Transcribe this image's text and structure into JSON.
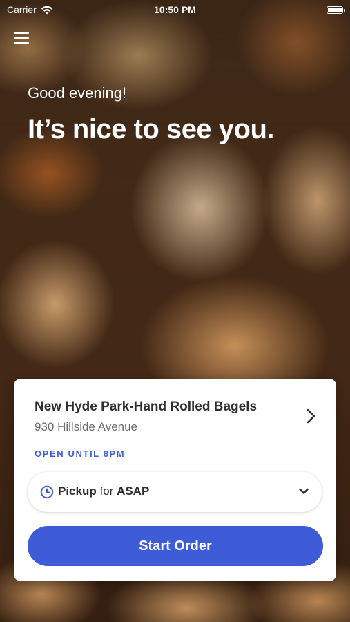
{
  "status_bar": {
    "carrier": "Carrier",
    "time": "10:50 PM"
  },
  "header": {
    "greeting": "Good evening!",
    "headline": "It’s nice to see you."
  },
  "store": {
    "name": "New Hyde Park-Hand Rolled Bagels",
    "address": "930 Hillside Avenue",
    "hours": "OPEN UNTIL 8PM"
  },
  "order": {
    "method": "Pickup",
    "for_word": "for",
    "time": "ASAP"
  },
  "actions": {
    "start_order": "Start Order"
  },
  "colors": {
    "accent": "#3e5bd8",
    "hours_text": "#3d5bd9",
    "card_background": "#ffffff"
  },
  "icons": {
    "menu": "hamburger-menu-icon",
    "wifi": "wifi-icon",
    "battery": "battery-icon",
    "store_chevron": "chevron-right-icon",
    "clock": "clock-icon",
    "dropdown": "chevron-down-icon"
  }
}
